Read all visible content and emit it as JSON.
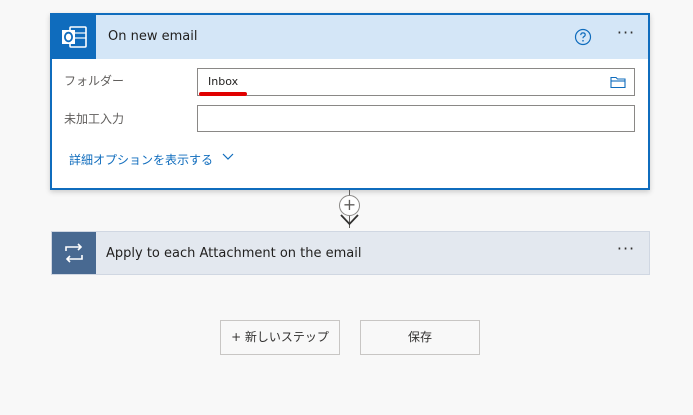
{
  "trigger": {
    "title": "On new email",
    "fields": {
      "folder_label": "フォルダー",
      "folder_value": "Inbox",
      "extra_label": "未加工入力",
      "extra_value": ""
    },
    "advanced_options_link": "詳細オプションを表示する",
    "more_label": "···"
  },
  "apply_each": {
    "title": "Apply to each Attachment on the email",
    "more_label": "···"
  },
  "connector": {
    "add_label": "+"
  },
  "actions": {
    "new_step_label": "+ 新しいステップ",
    "save_label": "保存"
  },
  "colors": {
    "accent": "#0f6cbd",
    "header_bg": "#d4e6f7",
    "apply_tile": "#486991",
    "highlight_underline": "#e00000"
  },
  "icons": {
    "trigger": "outlook-icon",
    "help": "help-icon",
    "folder_picker": "folder-icon",
    "loop": "loop-icon"
  }
}
